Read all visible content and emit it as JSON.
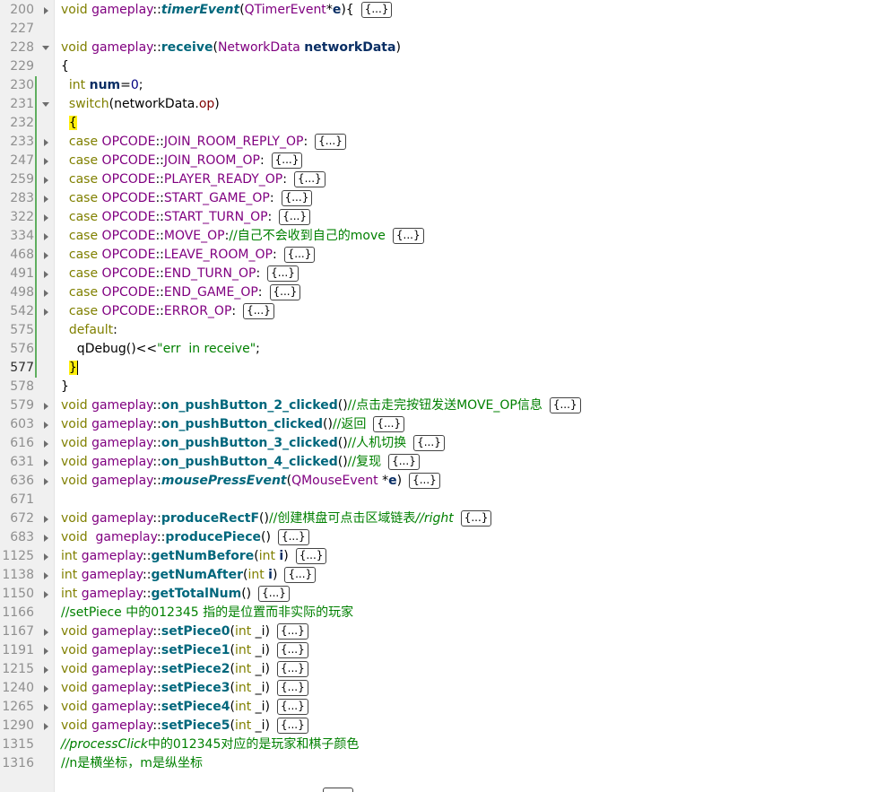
{
  "colors": {
    "keyword": "#808000",
    "class": "#800080",
    "function": "#00677c",
    "comment": "#008000",
    "gutter_bg": "#f0f0f0",
    "change_marker": "#5fae5f",
    "brace_highlight": "#ffef0b"
  },
  "folded_marker": "{...}",
  "lines": [
    {
      "num": "200",
      "fold": "right",
      "code": [
        {
          "c": "kw",
          "t": "void "
        },
        {
          "c": "cls",
          "t": "gameplay"
        },
        {
          "c": "op",
          "t": "::"
        },
        {
          "c": "fni",
          "t": "timerEvent"
        },
        {
          "c": "op",
          "t": "("
        },
        {
          "c": "cls",
          "t": "QTimerEvent"
        },
        {
          "c": "op",
          "t": "*"
        },
        {
          "c": "var",
          "t": "e"
        },
        {
          "c": "op",
          "t": "){"
        }
      ],
      "folded": true
    },
    {
      "num": "227",
      "code": []
    },
    {
      "num": "228",
      "fold": "down",
      "code": [
        {
          "c": "kw",
          "t": "void "
        },
        {
          "c": "cls",
          "t": "gameplay"
        },
        {
          "c": "op",
          "t": "::"
        },
        {
          "c": "fn",
          "t": "receive"
        },
        {
          "c": "op",
          "t": "("
        },
        {
          "c": "cls",
          "t": "NetworkData "
        },
        {
          "c": "var",
          "t": "networkData"
        },
        {
          "c": "op",
          "t": ")"
        }
      ]
    },
    {
      "num": "229",
      "code": [
        {
          "c": "op",
          "t": "{"
        }
      ]
    },
    {
      "num": "230",
      "chg": true,
      "code": [
        {
          "c": "op",
          "t": "  "
        },
        {
          "c": "kw",
          "t": "int "
        },
        {
          "c": "var",
          "t": "num"
        },
        {
          "c": "op",
          "t": "="
        },
        {
          "c": "num",
          "t": "0"
        },
        {
          "c": "op",
          "t": ";"
        }
      ]
    },
    {
      "num": "231",
      "chg": true,
      "fold": "down",
      "code": [
        {
          "c": "op",
          "t": "  "
        },
        {
          "c": "kw",
          "t": "switch"
        },
        {
          "c": "op",
          "t": "("
        },
        {
          "c": "op",
          "t": "networkData."
        },
        {
          "c": "mem",
          "t": "op"
        },
        {
          "c": "op",
          "t": ")"
        }
      ]
    },
    {
      "num": "232",
      "chg": true,
      "code": [
        {
          "c": "op",
          "t": "  "
        },
        {
          "c": "brace-hl",
          "t": "{"
        }
      ]
    },
    {
      "num": "233",
      "chg": true,
      "fold": "right",
      "code": [
        {
          "c": "op",
          "t": "  "
        },
        {
          "c": "kw",
          "t": "case "
        },
        {
          "c": "cls",
          "t": "OPCODE"
        },
        {
          "c": "op",
          "t": "::"
        },
        {
          "c": "cls",
          "t": "JOIN_ROOM_REPLY_OP"
        },
        {
          "c": "op",
          "t": ":"
        }
      ],
      "folded": true
    },
    {
      "num": "247",
      "chg": true,
      "fold": "right",
      "code": [
        {
          "c": "op",
          "t": "  "
        },
        {
          "c": "kw",
          "t": "case "
        },
        {
          "c": "cls",
          "t": "OPCODE"
        },
        {
          "c": "op",
          "t": "::"
        },
        {
          "c": "cls",
          "t": "JOIN_ROOM_OP"
        },
        {
          "c": "op",
          "t": ":"
        }
      ],
      "folded": true
    },
    {
      "num": "259",
      "chg": true,
      "fold": "right",
      "code": [
        {
          "c": "op",
          "t": "  "
        },
        {
          "c": "kw",
          "t": "case "
        },
        {
          "c": "cls",
          "t": "OPCODE"
        },
        {
          "c": "op",
          "t": "::"
        },
        {
          "c": "cls",
          "t": "PLAYER_READY_OP"
        },
        {
          "c": "op",
          "t": ":"
        }
      ],
      "folded": true
    },
    {
      "num": "283",
      "chg": true,
      "fold": "right",
      "code": [
        {
          "c": "op",
          "t": "  "
        },
        {
          "c": "kw",
          "t": "case "
        },
        {
          "c": "cls",
          "t": "OPCODE"
        },
        {
          "c": "op",
          "t": "::"
        },
        {
          "c": "cls",
          "t": "START_GAME_OP"
        },
        {
          "c": "op",
          "t": ":"
        }
      ],
      "folded": true
    },
    {
      "num": "322",
      "chg": true,
      "fold": "right",
      "code": [
        {
          "c": "op",
          "t": "  "
        },
        {
          "c": "kw",
          "t": "case "
        },
        {
          "c": "cls",
          "t": "OPCODE"
        },
        {
          "c": "op",
          "t": "::"
        },
        {
          "c": "cls",
          "t": "START_TURN_OP"
        },
        {
          "c": "op",
          "t": ":"
        }
      ],
      "folded": true
    },
    {
      "num": "334",
      "chg": true,
      "fold": "right",
      "code": [
        {
          "c": "op",
          "t": "  "
        },
        {
          "c": "kw",
          "t": "case "
        },
        {
          "c": "cls",
          "t": "OPCODE"
        },
        {
          "c": "op",
          "t": "::"
        },
        {
          "c": "cls",
          "t": "MOVE_OP"
        },
        {
          "c": "op",
          "t": ":"
        },
        {
          "c": "cm",
          "t": "//自己不会收到自己的move"
        }
      ],
      "folded": true
    },
    {
      "num": "468",
      "chg": true,
      "fold": "right",
      "code": [
        {
          "c": "op",
          "t": "  "
        },
        {
          "c": "kw",
          "t": "case "
        },
        {
          "c": "cls",
          "t": "OPCODE"
        },
        {
          "c": "op",
          "t": "::"
        },
        {
          "c": "cls",
          "t": "LEAVE_ROOM_OP"
        },
        {
          "c": "op",
          "t": ":"
        }
      ],
      "folded": true
    },
    {
      "num": "491",
      "chg": true,
      "fold": "right",
      "code": [
        {
          "c": "op",
          "t": "  "
        },
        {
          "c": "kw",
          "t": "case "
        },
        {
          "c": "cls",
          "t": "OPCODE"
        },
        {
          "c": "op",
          "t": "::"
        },
        {
          "c": "cls",
          "t": "END_TURN_OP"
        },
        {
          "c": "op",
          "t": ":"
        }
      ],
      "folded": true
    },
    {
      "num": "498",
      "chg": true,
      "fold": "right",
      "code": [
        {
          "c": "op",
          "t": "  "
        },
        {
          "c": "kw",
          "t": "case "
        },
        {
          "c": "cls",
          "t": "OPCODE"
        },
        {
          "c": "op",
          "t": "::"
        },
        {
          "c": "cls",
          "t": "END_GAME_OP"
        },
        {
          "c": "op",
          "t": ":"
        }
      ],
      "folded": true
    },
    {
      "num": "542",
      "chg": true,
      "fold": "right",
      "code": [
        {
          "c": "op",
          "t": "  "
        },
        {
          "c": "kw",
          "t": "case "
        },
        {
          "c": "cls",
          "t": "OPCODE"
        },
        {
          "c": "op",
          "t": "::"
        },
        {
          "c": "cls",
          "t": "ERROR_OP"
        },
        {
          "c": "op",
          "t": ":"
        }
      ],
      "folded": true
    },
    {
      "num": "575",
      "chg": true,
      "code": [
        {
          "c": "op",
          "t": "  "
        },
        {
          "c": "kw",
          "t": "default"
        },
        {
          "c": "op",
          "t": ":"
        }
      ]
    },
    {
      "num": "576",
      "chg": true,
      "code": [
        {
          "c": "op",
          "t": "    qDebug()<<"
        },
        {
          "c": "str",
          "t": "\"err  in receive\""
        },
        {
          "c": "op",
          "t": ";"
        }
      ]
    },
    {
      "num": "577",
      "chg": true,
      "cur": true,
      "code": [
        {
          "c": "op",
          "t": "  "
        },
        {
          "c": "brace-hl",
          "t": "}"
        }
      ],
      "cursor": true
    },
    {
      "num": "578",
      "code": [
        {
          "c": "op",
          "t": "}"
        }
      ]
    },
    {
      "num": "579",
      "fold": "right",
      "code": [
        {
          "c": "kw",
          "t": "void "
        },
        {
          "c": "cls",
          "t": "gameplay"
        },
        {
          "c": "op",
          "t": "::"
        },
        {
          "c": "fn",
          "t": "on_pushButton_2_clicked"
        },
        {
          "c": "op",
          "t": "()"
        },
        {
          "c": "cm",
          "t": "//点击走完按钮发送MOVE_OP信息"
        }
      ],
      "folded": true
    },
    {
      "num": "603",
      "fold": "right",
      "code": [
        {
          "c": "kw",
          "t": "void "
        },
        {
          "c": "cls",
          "t": "gameplay"
        },
        {
          "c": "op",
          "t": "::"
        },
        {
          "c": "fn",
          "t": "on_pushButton_clicked"
        },
        {
          "c": "op",
          "t": "()"
        },
        {
          "c": "cm",
          "t": "//返回"
        }
      ],
      "folded": true
    },
    {
      "num": "616",
      "fold": "right",
      "code": [
        {
          "c": "kw",
          "t": "void "
        },
        {
          "c": "cls",
          "t": "gameplay"
        },
        {
          "c": "op",
          "t": "::"
        },
        {
          "c": "fn",
          "t": "on_pushButton_3_clicked"
        },
        {
          "c": "op",
          "t": "()"
        },
        {
          "c": "cm",
          "t": "//人机切换"
        }
      ],
      "folded": true
    },
    {
      "num": "631",
      "fold": "right",
      "code": [
        {
          "c": "kw",
          "t": "void "
        },
        {
          "c": "cls",
          "t": "gameplay"
        },
        {
          "c": "op",
          "t": "::"
        },
        {
          "c": "fn",
          "t": "on_pushButton_4_clicked"
        },
        {
          "c": "op",
          "t": "()"
        },
        {
          "c": "cm",
          "t": "//复现"
        }
      ],
      "folded": true
    },
    {
      "num": "636",
      "fold": "right",
      "code": [
        {
          "c": "kw",
          "t": "void "
        },
        {
          "c": "cls",
          "t": "gameplay"
        },
        {
          "c": "op",
          "t": "::"
        },
        {
          "c": "fni",
          "t": "mousePressEvent"
        },
        {
          "c": "op",
          "t": "("
        },
        {
          "c": "cls",
          "t": "QMouseEvent "
        },
        {
          "c": "op",
          "t": "*"
        },
        {
          "c": "var",
          "t": "e"
        },
        {
          "c": "op",
          "t": ")"
        }
      ],
      "folded": true
    },
    {
      "num": "671",
      "code": []
    },
    {
      "num": "672",
      "fold": "right",
      "code": [
        {
          "c": "kw",
          "t": "void "
        },
        {
          "c": "cls",
          "t": "gameplay"
        },
        {
          "c": "op",
          "t": "::"
        },
        {
          "c": "fn",
          "t": "produceRectF"
        },
        {
          "c": "op",
          "t": "()"
        },
        {
          "c": "cm",
          "t": "//创建棋盘可点击区域链表"
        },
        {
          "c": "cmi",
          "t": "//right"
        }
      ],
      "folded": true
    },
    {
      "num": "683",
      "fold": "right",
      "code": [
        {
          "c": "kw",
          "t": "void  "
        },
        {
          "c": "cls",
          "t": "gameplay"
        },
        {
          "c": "op",
          "t": "::"
        },
        {
          "c": "fn",
          "t": "producePiece"
        },
        {
          "c": "op",
          "t": "()"
        }
      ],
      "folded": true
    },
    {
      "num": "1125",
      "fold": "right",
      "code": [
        {
          "c": "kw",
          "t": "int "
        },
        {
          "c": "cls",
          "t": "gameplay"
        },
        {
          "c": "op",
          "t": "::"
        },
        {
          "c": "fn",
          "t": "getNumBefore"
        },
        {
          "c": "op",
          "t": "("
        },
        {
          "c": "kw",
          "t": "int "
        },
        {
          "c": "var",
          "t": "i"
        },
        {
          "c": "op",
          "t": ")"
        }
      ],
      "folded": true
    },
    {
      "num": "1138",
      "fold": "right",
      "code": [
        {
          "c": "kw",
          "t": "int "
        },
        {
          "c": "cls",
          "t": "gameplay"
        },
        {
          "c": "op",
          "t": "::"
        },
        {
          "c": "fn",
          "t": "getNumAfter"
        },
        {
          "c": "op",
          "t": "("
        },
        {
          "c": "kw",
          "t": "int "
        },
        {
          "c": "var",
          "t": "i"
        },
        {
          "c": "op",
          "t": ")"
        }
      ],
      "folded": true
    },
    {
      "num": "1150",
      "fold": "right",
      "code": [
        {
          "c": "kw",
          "t": "int "
        },
        {
          "c": "cls",
          "t": "gameplay"
        },
        {
          "c": "op",
          "t": "::"
        },
        {
          "c": "fn",
          "t": "getTotalNum"
        },
        {
          "c": "op",
          "t": "()"
        }
      ],
      "folded": true
    },
    {
      "num": "1166",
      "code": [
        {
          "c": "cm",
          "t": "//setPiece 中的012345 指的是位置而非实际的玩家"
        }
      ]
    },
    {
      "num": "1167",
      "fold": "right",
      "code": [
        {
          "c": "kw",
          "t": "void "
        },
        {
          "c": "cls",
          "t": "gameplay"
        },
        {
          "c": "op",
          "t": "::"
        },
        {
          "c": "fn",
          "t": "setPiece0"
        },
        {
          "c": "op",
          "t": "("
        },
        {
          "c": "kw",
          "t": "int "
        },
        {
          "c": "op",
          "t": "_i)"
        }
      ],
      "folded": true
    },
    {
      "num": "1191",
      "fold": "right",
      "code": [
        {
          "c": "kw",
          "t": "void "
        },
        {
          "c": "cls",
          "t": "gameplay"
        },
        {
          "c": "op",
          "t": "::"
        },
        {
          "c": "fn",
          "t": "setPiece1"
        },
        {
          "c": "op",
          "t": "("
        },
        {
          "c": "kw",
          "t": "int "
        },
        {
          "c": "op",
          "t": "_i)"
        }
      ],
      "folded": true
    },
    {
      "num": "1215",
      "fold": "right",
      "code": [
        {
          "c": "kw",
          "t": "void "
        },
        {
          "c": "cls",
          "t": "gameplay"
        },
        {
          "c": "op",
          "t": "::"
        },
        {
          "c": "fn",
          "t": "setPiece2"
        },
        {
          "c": "op",
          "t": "("
        },
        {
          "c": "kw",
          "t": "int "
        },
        {
          "c": "op",
          "t": "_i)"
        }
      ],
      "folded": true
    },
    {
      "num": "1240",
      "fold": "right",
      "code": [
        {
          "c": "kw",
          "t": "void "
        },
        {
          "c": "cls",
          "t": "gameplay"
        },
        {
          "c": "op",
          "t": "::"
        },
        {
          "c": "fn",
          "t": "setPiece3"
        },
        {
          "c": "op",
          "t": "("
        },
        {
          "c": "kw",
          "t": "int "
        },
        {
          "c": "op",
          "t": "_i)"
        }
      ],
      "folded": true
    },
    {
      "num": "1265",
      "fold": "right",
      "code": [
        {
          "c": "kw",
          "t": "void "
        },
        {
          "c": "cls",
          "t": "gameplay"
        },
        {
          "c": "op",
          "t": "::"
        },
        {
          "c": "fn",
          "t": "setPiece4"
        },
        {
          "c": "op",
          "t": "("
        },
        {
          "c": "kw",
          "t": "int "
        },
        {
          "c": "op",
          "t": "_i)"
        }
      ],
      "folded": true
    },
    {
      "num": "1290",
      "fold": "right",
      "code": [
        {
          "c": "kw",
          "t": "void "
        },
        {
          "c": "cls",
          "t": "gameplay"
        },
        {
          "c": "op",
          "t": "::"
        },
        {
          "c": "fn",
          "t": "setPiece5"
        },
        {
          "c": "op",
          "t": "("
        },
        {
          "c": "kw",
          "t": "int "
        },
        {
          "c": "op",
          "t": "_i)"
        }
      ],
      "folded": true
    },
    {
      "num": "1315",
      "code": [
        {
          "c": "cmi",
          "t": "//processClick"
        },
        {
          "c": "cm",
          "t": "中的012345对应的是玩家和棋子颜色"
        }
      ]
    },
    {
      "num": "1316",
      "code": [
        {
          "c": "cm",
          "t": "//n是横坐标，m是纵坐标"
        }
      ]
    }
  ]
}
